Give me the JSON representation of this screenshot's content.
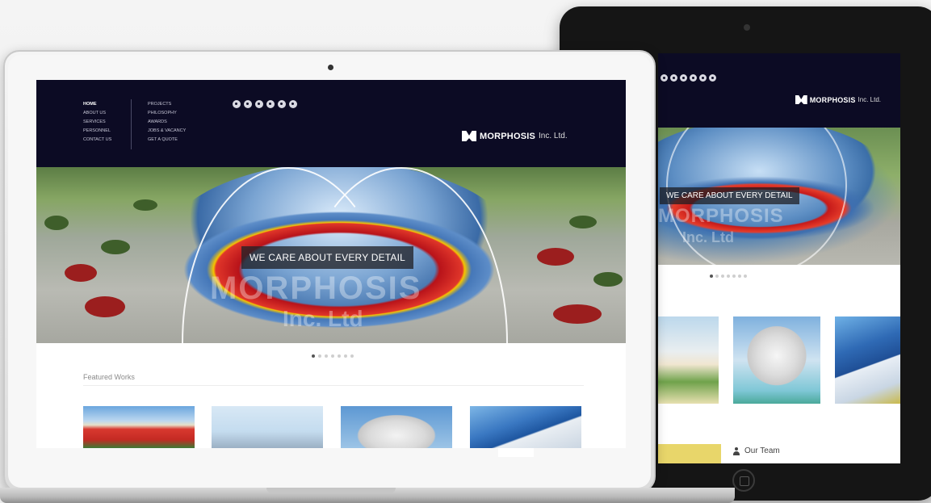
{
  "laptop": {
    "nav": {
      "col1": [
        "HOME",
        "ABOUT US",
        "SERVICES",
        "PERSONNEL",
        "CONTACT US"
      ],
      "col2": [
        "PROJECTS",
        "PHILOSOPHY",
        "AWARDS",
        "JOBS & VACANCY",
        "GET A QUOTE"
      ]
    },
    "social_icons": [
      "facebook-icon",
      "linkedin-icon",
      "twitter-icon",
      "instagram-icon",
      "flickr-icon",
      "mail-icon"
    ],
    "logo": {
      "name": "MORPHOSIS",
      "suffix": "Inc. Ltd."
    },
    "hero": {
      "caption": "WE CARE ABOUT EVERY DETAIL",
      "watermark_line1": "MORPHOSIS",
      "watermark_line2": "Inc. Ltd"
    },
    "slider": {
      "count": 7,
      "active": 0
    },
    "featured_title": "Featured Works"
  },
  "tablet": {
    "social_icons": [
      "facebook-icon",
      "linkedin-icon",
      "twitter-icon",
      "instagram-icon",
      "flickr-icon",
      "mail-icon"
    ],
    "logo": {
      "name": "MORPHOSIS",
      "suffix": "Inc. Ltd."
    },
    "hero": {
      "caption": "WE CARE ABOUT EVERY DETAIL",
      "watermark_line1": "MORPHOSIS",
      "watermark_line2": "Inc. Ltd"
    },
    "slider": {
      "count": 7,
      "active": 0
    },
    "team_label": "Our Team"
  },
  "colors": {
    "header": "#0c0b24",
    "accent_red": "#c61a1a",
    "accent_blue": "#3b6ea8"
  }
}
